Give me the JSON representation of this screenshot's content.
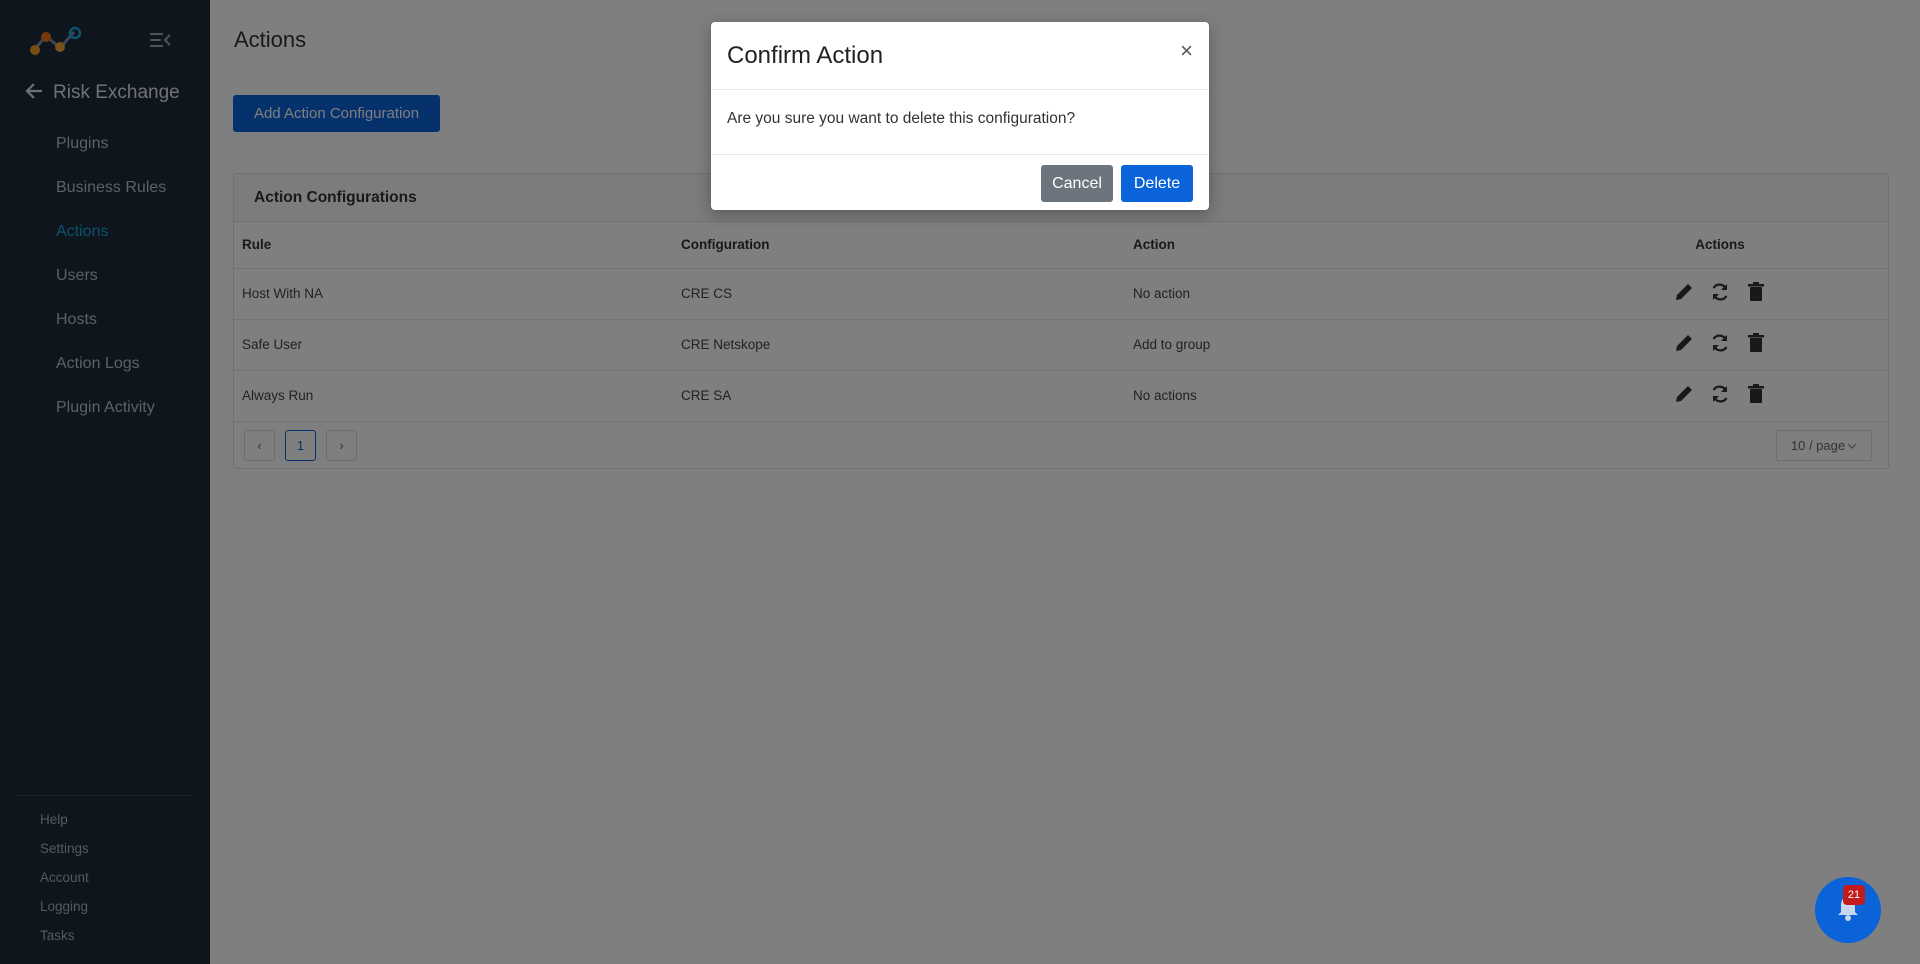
{
  "sidebar": {
    "back_title": "Risk Exchange",
    "nav": [
      {
        "label": "Plugins"
      },
      {
        "label": "Business Rules"
      },
      {
        "label": "Actions",
        "active": true
      },
      {
        "label": "Users"
      },
      {
        "label": "Hosts"
      },
      {
        "label": "Action Logs"
      },
      {
        "label": "Plugin Activity"
      }
    ],
    "bottom": [
      {
        "label": "Help"
      },
      {
        "label": "Settings"
      },
      {
        "label": "Account"
      },
      {
        "label": "Logging"
      },
      {
        "label": "Tasks"
      }
    ]
  },
  "main": {
    "title": "Actions",
    "add_button": "Add Action Configuration",
    "card_title": "Action Configurations",
    "table": {
      "headers": [
        "Rule",
        "Configuration",
        "Action",
        "Actions"
      ],
      "rows": [
        {
          "rule": "Host With NA",
          "configuration": "CRE CS",
          "action": "No action"
        },
        {
          "rule": "Safe User",
          "configuration": "CRE Netskope",
          "action": "Add to group"
        },
        {
          "rule": "Always Run",
          "configuration": "CRE SA",
          "action": "No actions"
        }
      ]
    },
    "pagination": {
      "prev": "‹",
      "current": "1",
      "next": "›",
      "per_page": "10 / page"
    }
  },
  "modal": {
    "title": "Confirm Action",
    "close": "×",
    "message": "Are you sure you want to delete this configuration?",
    "cancel": "Cancel",
    "delete": "Delete"
  },
  "notifications": {
    "count": "21"
  },
  "colors": {
    "sidebar_bg": "#1c2a39",
    "accent": "#0b63d9",
    "active_nav": "#1aa3e0",
    "badge": "#c11b1b"
  },
  "icons": [
    "app-logo-icon",
    "menu-collapse-icon",
    "arrow-left-icon",
    "edit-icon",
    "sync-icon",
    "trash-icon",
    "bell-icon",
    "close-icon"
  ]
}
